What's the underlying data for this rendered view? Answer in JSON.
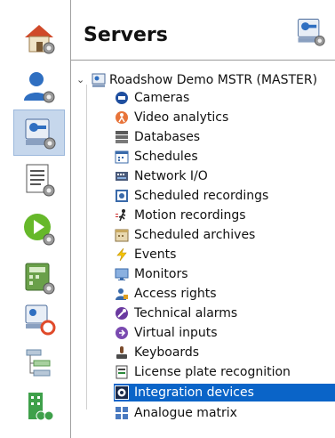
{
  "header": {
    "title": "Servers",
    "icon": "server-settings-icon"
  },
  "sidebar": {
    "items": [
      {
        "name": "home",
        "icon": "home-settings-icon"
      },
      {
        "name": "users",
        "icon": "user-settings-icon"
      },
      {
        "name": "servers",
        "icon": "server-settings-icon",
        "selected": true
      },
      {
        "name": "lists",
        "icon": "list-settings-icon"
      },
      {
        "name": "playback",
        "icon": "play-settings-icon"
      },
      {
        "name": "modules",
        "icon": "panel-settings-icon"
      },
      {
        "name": "server-support",
        "icon": "server-lifebuoy-icon"
      },
      {
        "name": "hierarchy",
        "icon": "hierarchy-icon"
      },
      {
        "name": "organization",
        "icon": "building-people-icon"
      }
    ]
  },
  "tree": {
    "root": {
      "label": "Roadshow Demo MSTR (MASTER)",
      "expanded": true
    },
    "items": [
      {
        "label": "Cameras",
        "icon": "camera-icon"
      },
      {
        "label": "Video analytics",
        "icon": "video-analytics-icon"
      },
      {
        "label": "Databases",
        "icon": "database-icon"
      },
      {
        "label": "Schedules",
        "icon": "calendar-icon"
      },
      {
        "label": "Network I/O",
        "icon": "network-io-icon"
      },
      {
        "label": "Scheduled recordings",
        "icon": "scheduled-recording-icon"
      },
      {
        "label": "Motion recordings",
        "icon": "motion-icon"
      },
      {
        "label": "Scheduled archives",
        "icon": "archive-icon"
      },
      {
        "label": "Events",
        "icon": "lightning-icon"
      },
      {
        "label": "Monitors",
        "icon": "monitor-icon"
      },
      {
        "label": "Access rights",
        "icon": "access-rights-icon"
      },
      {
        "label": "Technical alarms",
        "icon": "technical-alarm-icon"
      },
      {
        "label": "Virtual inputs",
        "icon": "virtual-input-icon"
      },
      {
        "label": "Keyboards",
        "icon": "keyboard-icon"
      },
      {
        "label": "License plate recognition",
        "icon": "license-plate-icon"
      },
      {
        "label": "Integration devices",
        "icon": "integration-gear-icon",
        "selected": true
      },
      {
        "label": "Analogue matrix",
        "icon": "matrix-grid-icon"
      }
    ]
  },
  "colors": {
    "selection": "#0a64c8",
    "sidebar_selected": "#c6d7ec"
  }
}
